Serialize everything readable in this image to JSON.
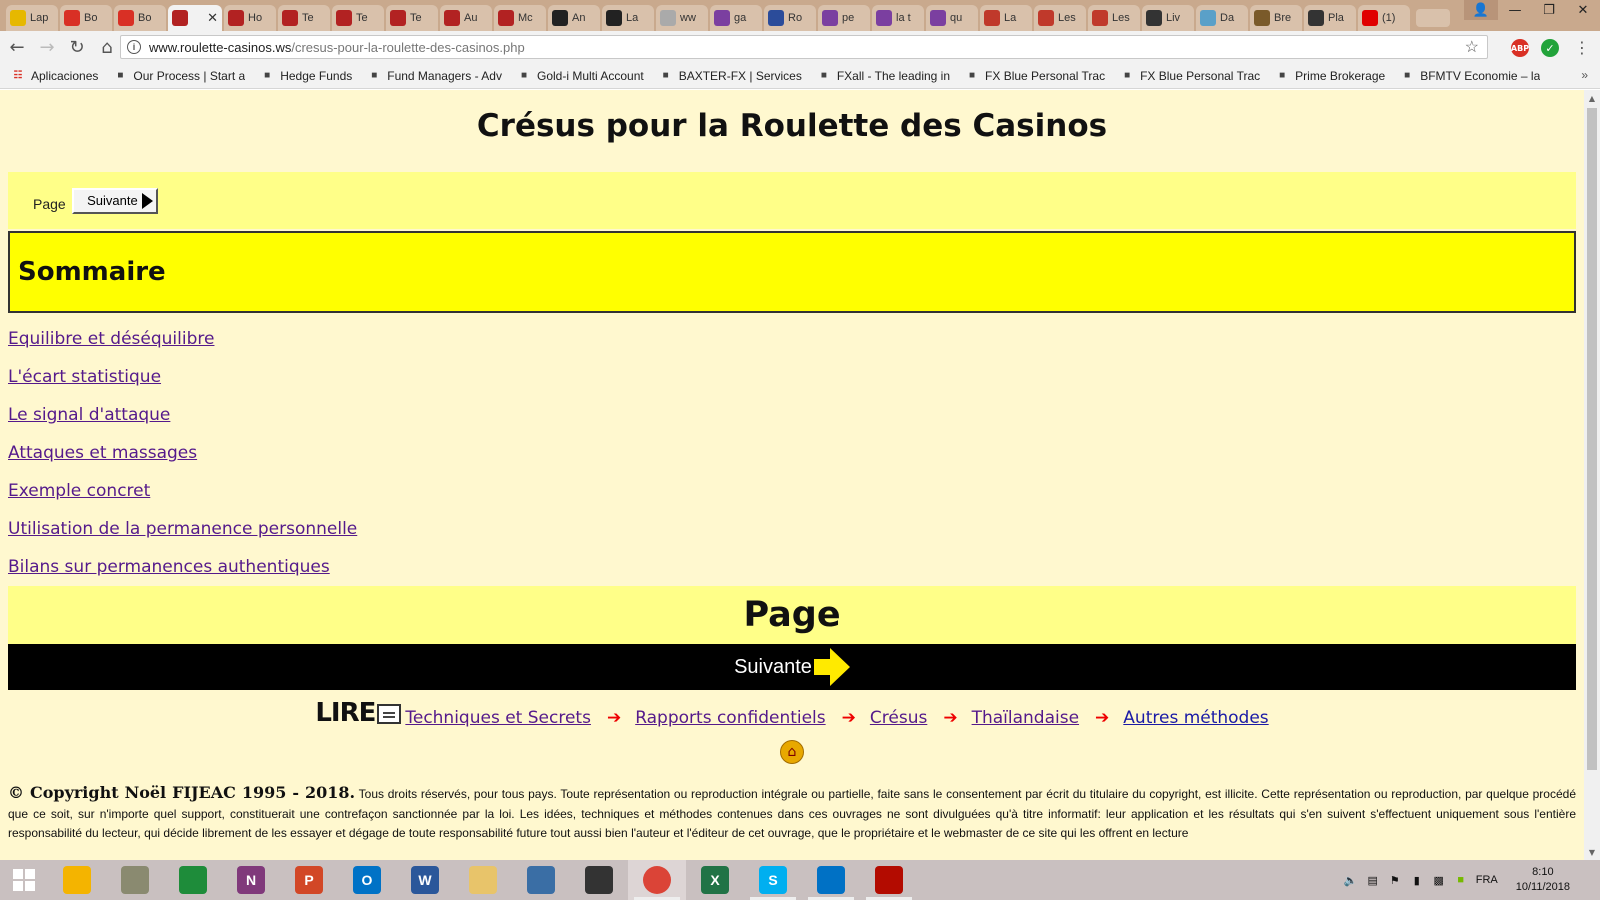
{
  "browser": {
    "tabs": [
      {
        "label": "Lap",
        "icon": "envelope-icon",
        "color": "#e6b800"
      },
      {
        "label": "Bo",
        "icon": "gmail-icon",
        "color": "#d93025"
      },
      {
        "label": "Bo",
        "icon": "gmail-icon",
        "color": "#d93025"
      },
      {
        "label": "",
        "icon": "roulette-icon",
        "color": "#b22222",
        "active": true
      },
      {
        "label": "Ho",
        "icon": "roulette-icon",
        "color": "#b22222"
      },
      {
        "label": "Te",
        "icon": "roulette-icon",
        "color": "#b22222"
      },
      {
        "label": "Te",
        "icon": "roulette-icon",
        "color": "#b22222"
      },
      {
        "label": "Te",
        "icon": "roulette-icon",
        "color": "#b22222"
      },
      {
        "label": "Au",
        "icon": "roulette-icon",
        "color": "#b22222"
      },
      {
        "label": "Mc",
        "icon": "roulette-icon",
        "color": "#b22222"
      },
      {
        "label": "An",
        "icon": "amazon-icon",
        "color": "#222222"
      },
      {
        "label": "La",
        "icon": "amazon-icon",
        "color": "#222222"
      },
      {
        "label": "ww",
        "icon": "page-icon",
        "color": "#aaaaaa"
      },
      {
        "label": "ga",
        "icon": "m-icon",
        "color": "#7b3fa0"
      },
      {
        "label": "Ro",
        "icon": "sj-icon",
        "color": "#2b4c9a"
      },
      {
        "label": "pe",
        "icon": "m-icon",
        "color": "#7b3fa0"
      },
      {
        "label": "la t",
        "icon": "m-icon",
        "color": "#7b3fa0"
      },
      {
        "label": "qu",
        "icon": "m-icon",
        "color": "#7b3fa0"
      },
      {
        "label": "La",
        "icon": "book-icon",
        "color": "#c0392b"
      },
      {
        "label": "Les",
        "icon": "book-icon",
        "color": "#c0392b"
      },
      {
        "label": "Les",
        "icon": "book-icon",
        "color": "#c0392b"
      },
      {
        "label": "Liv",
        "icon": "plus-icon",
        "color": "#333333"
      },
      {
        "label": "Da",
        "icon": "cat-icon",
        "color": "#5aa0c8"
      },
      {
        "label": "Bre",
        "icon": "globe-icon",
        "color": "#7a5a2a"
      },
      {
        "label": "Pla",
        "icon": "app-icon",
        "color": "#333333"
      },
      {
        "label": "(1)",
        "icon": "youtube-icon",
        "color": "#e00000"
      }
    ],
    "url_host": "www.roulette-casinos.ws",
    "url_path": "/cresus-pour-la-roulette-des-casinos.php",
    "bookmarks": [
      {
        "label": "Aplicaciones",
        "icon": "apps-grid-icon"
      },
      {
        "label": "Our Process | Start a",
        "icon": "page-icon"
      },
      {
        "label": "Hedge Funds",
        "icon": "sh-icon"
      },
      {
        "label": "Fund Managers - Adv",
        "icon": "fm-icon"
      },
      {
        "label": "Gold-i Multi Account",
        "icon": "gold-icon"
      },
      {
        "label": "BAXTER-FX | Services",
        "icon": "baxter-icon"
      },
      {
        "label": "FXall - The leading in",
        "icon": "fxall-icon"
      },
      {
        "label": "FX Blue Personal Trac",
        "icon": "fxblue-icon"
      },
      {
        "label": "FX Blue Personal Trac",
        "icon": "fxblue-icon"
      },
      {
        "label": "Prime Brokerage",
        "icon": "pb-icon"
      },
      {
        "label": "BFMTV Economie – la",
        "icon": "bfm-icon"
      }
    ]
  },
  "page": {
    "title": "Crésus pour la Roulette des Casinos",
    "page_label": "Page",
    "next_label": "Suivante",
    "sommaire": "Sommaire",
    "links": [
      "Equilibre et déséquilibre",
      "L'écart statistique",
      "Le signal d'attaque ",
      "Attaques et massages ",
      "Exemple concret ",
      "Utilisation de la permanence personnelle ",
      "Bilans sur permanences authentiques "
    ],
    "footer_page_label": "Page",
    "footer_next_label": "Suivante",
    "lire_label": "LIRE",
    "nav_links": [
      "Techniques et Secrets",
      "Rapports confidentiels",
      "Crésus",
      "Thaïlandaise",
      "Autres méthodes"
    ],
    "copyright_bold": "© Copyright Noël FIJEAC 1995 - 2018.",
    "copyright_text": " Tous droits réservés, pour tous pays. Toute représentation ou reproduction intégrale ou partielle, faite sans le consentement par écrit du titulaire du copyright, est illicite. Cette représentation ou reproduction, par quelque procédé que ce soit, sur n'importe quel support, constituerait une contrefaçon sanctionnée par la loi. Les idées, techniques et méthodes contenues dans ces ouvrages ne sont divulguées qu'à titre informatif: leur application et les résultats qui s'en suivent s'effectuent uniquement sous l'entière responsabilité du lecteur, qui décide librement de les essayer et dégage de toute responsabilité future tout aussi bien l'auteur et l'éditeur de cet ouvrage, que le propriétaire et le webmaster de ce site qui les offrent en lecture"
  },
  "taskbar": {
    "apps": [
      {
        "name": "chrome-canary-icon",
        "letter": "",
        "color": "#f4b400"
      },
      {
        "name": "notepad-icon",
        "letter": "",
        "color": "#8a8a70"
      },
      {
        "name": "store-icon",
        "letter": "",
        "color": "#1e8c3a"
      },
      {
        "name": "onenote-icon",
        "letter": "N",
        "color": "#80397b"
      },
      {
        "name": "powerpoint-icon",
        "letter": "P",
        "color": "#d24726"
      },
      {
        "name": "outlook-icon",
        "letter": "O",
        "color": "#0072c6"
      },
      {
        "name": "word-icon",
        "letter": "W",
        "color": "#2b579a"
      },
      {
        "name": "file-explorer-icon",
        "letter": "",
        "color": "#e8c46a"
      },
      {
        "name": "owl-icon",
        "letter": "",
        "color": "#3a6ea5"
      },
      {
        "name": "owl-dark-icon",
        "letter": "",
        "color": "#333333"
      },
      {
        "name": "chrome-icon",
        "letter": "",
        "color": "#db4437"
      },
      {
        "name": "excel-icon",
        "letter": "X",
        "color": "#217346"
      },
      {
        "name": "skype-icon",
        "letter": "S",
        "color": "#00aff0"
      },
      {
        "name": "intel-icon",
        "letter": "",
        "color": "#0071c5"
      },
      {
        "name": "acrobat-icon",
        "letter": "",
        "color": "#b30b00"
      }
    ],
    "language": "FRA",
    "time": "8:10",
    "date": "10/11/2018"
  }
}
